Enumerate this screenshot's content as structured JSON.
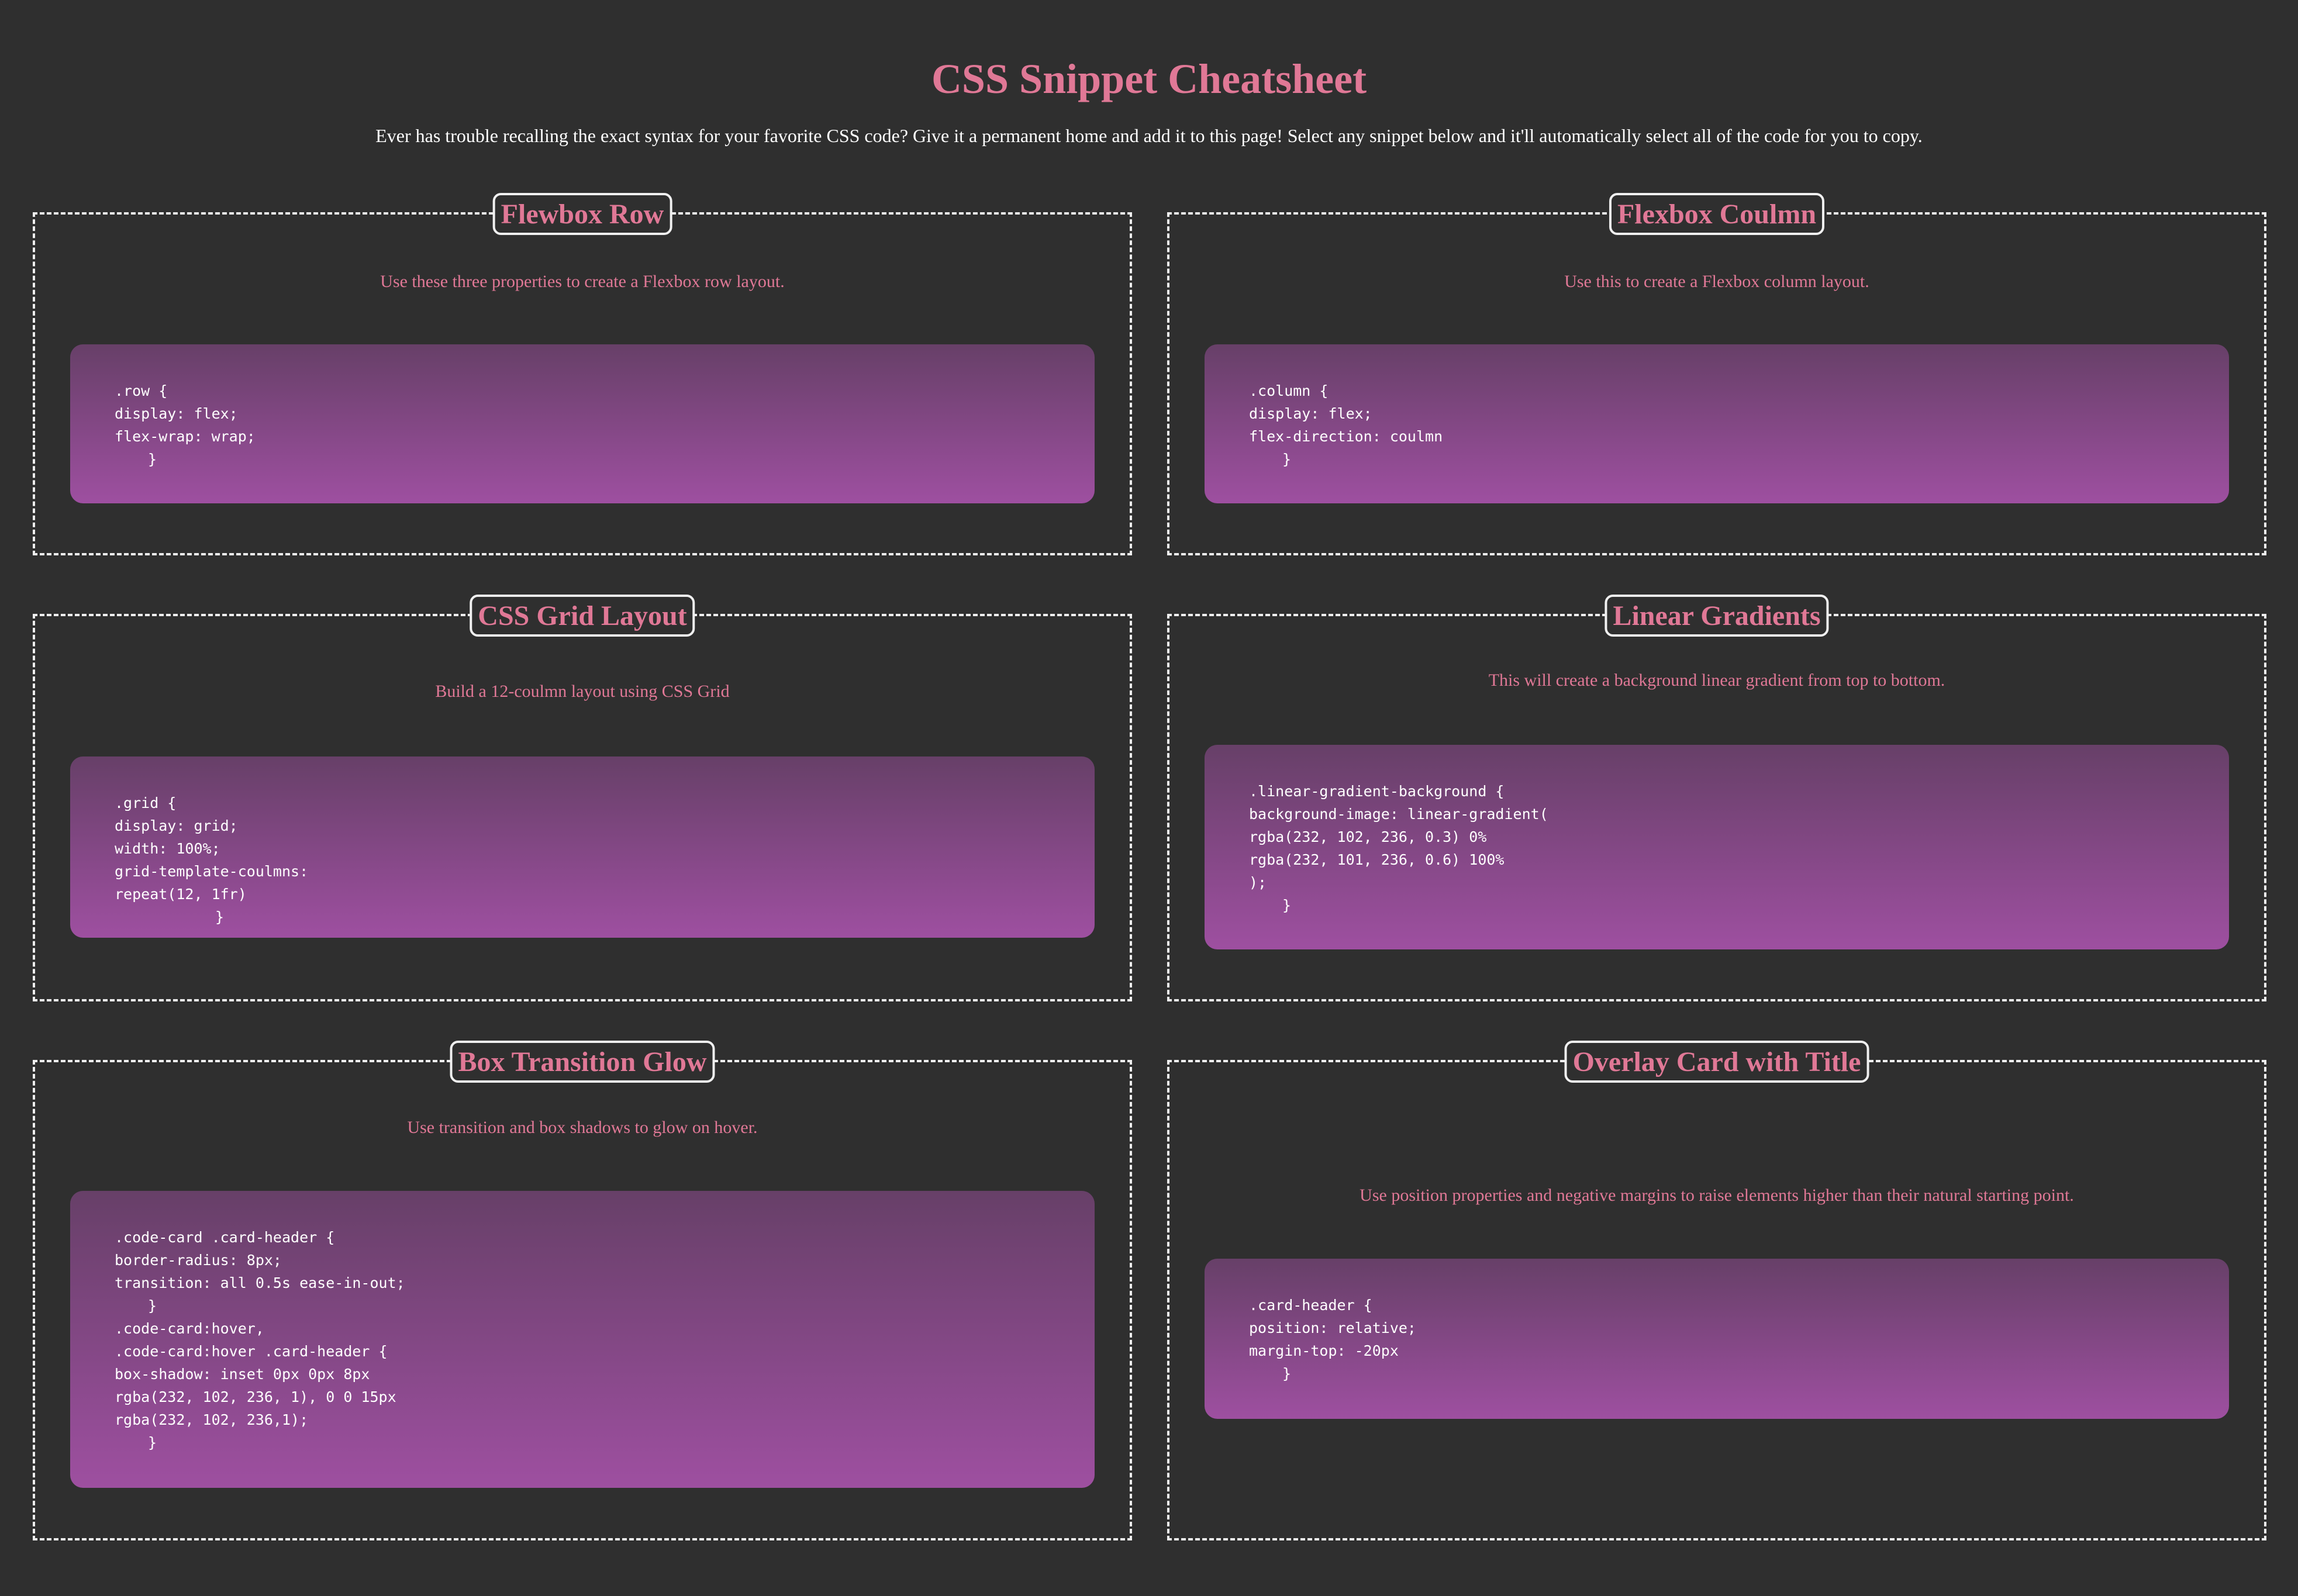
{
  "page": {
    "title": "CSS Snippet Cheatsheet",
    "subtitle": "Ever has trouble recalling the exact syntax for your favorite CSS code? Give it a permanent home and add it to this page! Select any snippet below and it'll automatically select all of the code for you to copy."
  },
  "colors": {
    "background": "#2f2f2f",
    "accent": "#e07896",
    "code_gradient_top": "rgba(232, 102, 236, 0.3)",
    "code_gradient_bottom": "rgba(232, 101, 236, 0.6)"
  },
  "cards": [
    {
      "title": "Flewbox Row",
      "description": "Use these three properties to create a Flexbox row layout.",
      "code": [
        ".row {",
        "display: flex;",
        "flex-wrap: wrap;",
        "}"
      ]
    },
    {
      "title": "Flexbox Coulmn",
      "description": "Use this to create a Flexbox column layout.",
      "code": [
        ".column {",
        "display: flex;",
        "flex-direction: coulmn",
        "}"
      ]
    },
    {
      "title": "CSS Grid Layout",
      "description": "Build a 12-coulmn layout using CSS Grid",
      "code": [
        ".grid {",
        "display: grid;",
        "width: 100%;",
        "grid-template-coulmns:",
        "repeat(12, 1fr)",
        "}"
      ]
    },
    {
      "title": "Linear Gradients",
      "description": "This will create a background linear gradient from top to bottom.",
      "code": [
        ".linear-gradient-background {",
        "background-image: linear-gradient(",
        "rgba(232, 102, 236, 0.3) 0%",
        "rgba(232, 101, 236, 0.6) 100%",
        ");",
        "}"
      ]
    },
    {
      "title": "Box Transition Glow",
      "description": "Use transition and box shadows to glow on hover.",
      "code": [
        ".code-card .card-header {",
        "border-radius: 8px;",
        "transition: all 0.5s ease-in-out;",
        "}",
        ".code-card:hover,",
        ".code-card:hover .card-header {",
        "box-shadow: inset 0px 0px 8px",
        "rgba(232, 102, 236, 1), 0 0 15px",
        "rgba(232, 102, 236,1);",
        "}"
      ]
    },
    {
      "title": "Overlay Card with Title",
      "description": "Use position properties and negative margins to raise elements higher than their natural starting point.",
      "code": [
        ".card-header {",
        "position: relative;",
        "margin-top: -20px",
        "}"
      ]
    }
  ]
}
